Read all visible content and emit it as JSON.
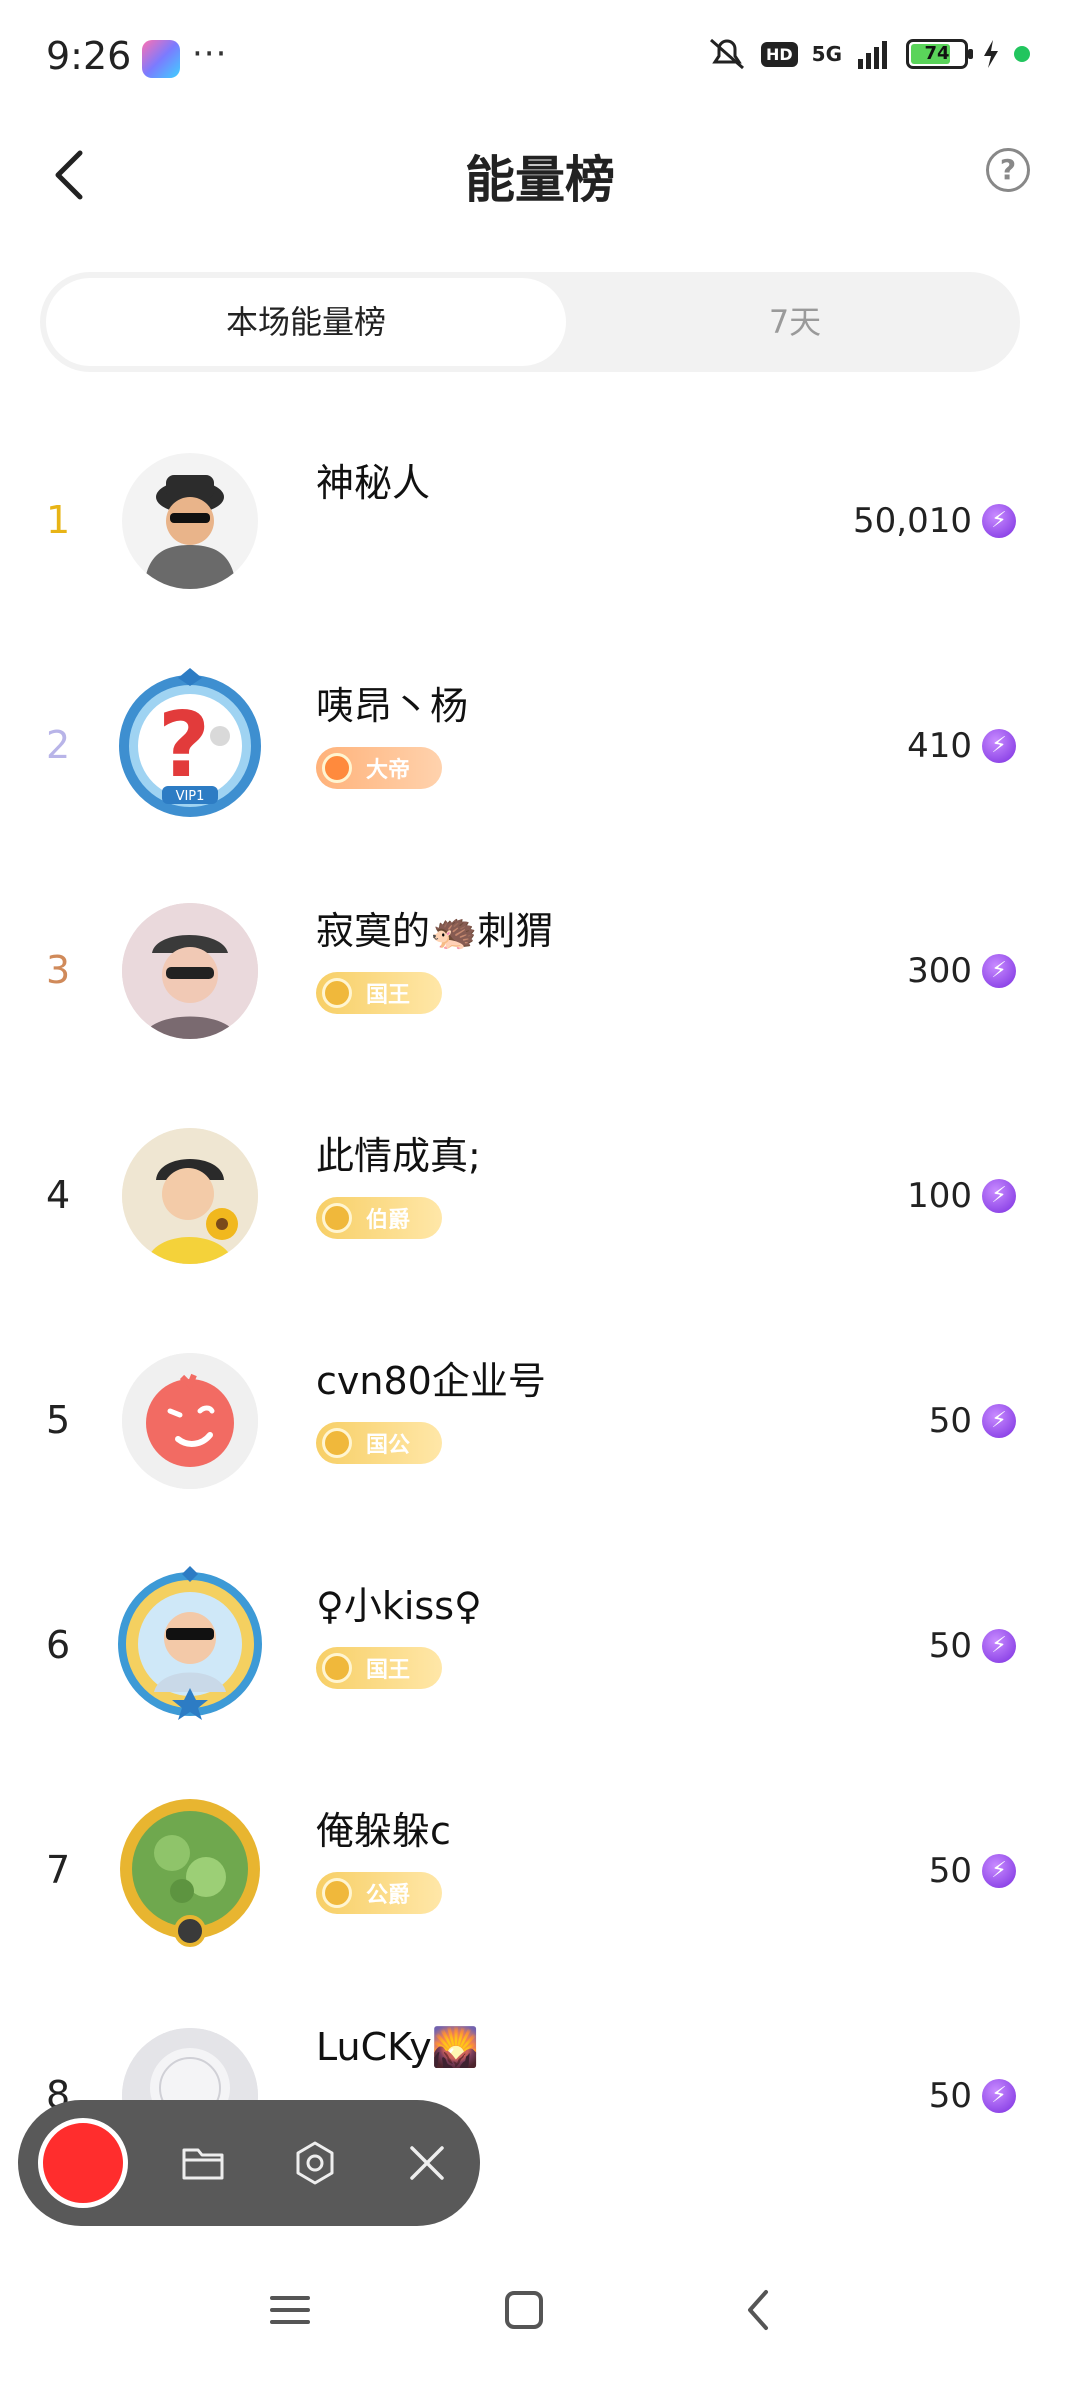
{
  "status": {
    "time": "9:26",
    "dots": "···",
    "hd": "HD",
    "network": "5G",
    "battery": "74"
  },
  "header": {
    "title": "能量榜",
    "help": "?"
  },
  "tabs": [
    {
      "label": "本场能量榜",
      "active": true
    },
    {
      "label": "7天",
      "active": false
    }
  ],
  "ranking": [
    {
      "rank": "1",
      "name": "神秘人",
      "badge": "",
      "score": "50,010"
    },
    {
      "rank": "2",
      "name": "咦昂丶杨",
      "badge": "大帝",
      "score": "410"
    },
    {
      "rank": "3",
      "name": "寂寞的🦔刺猬",
      "badge": "国王",
      "score": "300"
    },
    {
      "rank": "4",
      "name": "此情成真;",
      "badge": "伯爵",
      "score": "100"
    },
    {
      "rank": "5",
      "name": "cvn80企业号",
      "badge": "国公",
      "score": "50"
    },
    {
      "rank": "6",
      "name": "♀小kiss♀",
      "badge": "国王",
      "score": "50"
    },
    {
      "rank": "7",
      "name": "俺躲躲c",
      "badge": "公爵",
      "score": "50"
    },
    {
      "rank": "8",
      "name": "LuCKy🌄",
      "badge": "",
      "score": "50"
    }
  ],
  "colors": {
    "rank1": "#e8b416",
    "rank2": "#b8b4e8",
    "rank3": "#d08a5a",
    "energy": "#8a3ff0",
    "record": "#ff2d2d"
  }
}
